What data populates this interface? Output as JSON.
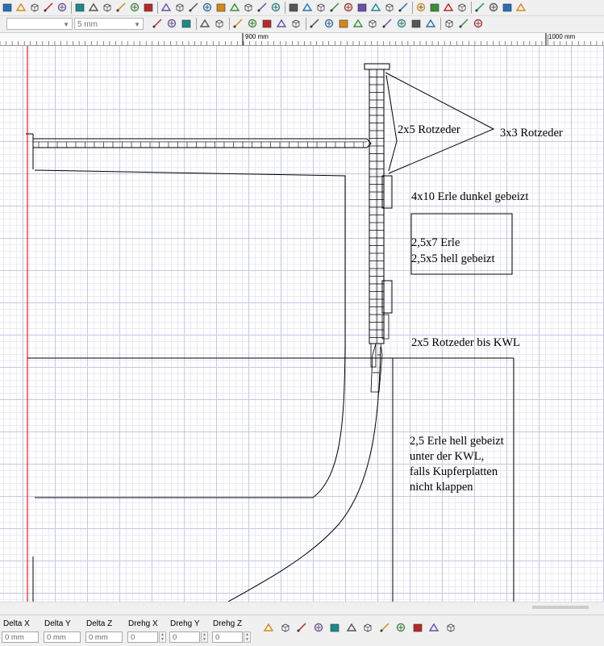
{
  "toolbar": {
    "layer_combo_value": "",
    "grid_combo_value": "5 mm",
    "icons_row1": [
      "open-folder-icon",
      "plot-icon",
      "measure-icon",
      "capture-icon",
      "stack-icon",
      "select-icon",
      "help-pointer-icon",
      "copy-icon",
      "print-icon",
      "paste-icon",
      "new-doc-icon",
      "axis-icon",
      "cube-top-icon",
      "cube-front-icon",
      "cube-side-icon",
      "cube-iso-icon",
      "cube-back-icon",
      "cube-right-icon",
      "cube-bottom-icon",
      "cube-view-icon",
      "surface-icon",
      "tilt-icon",
      "hull-icon",
      "point-icon",
      "curve-icon",
      "shape-icon",
      "line-icon",
      "flag-icon",
      "pin-icon",
      "grid-view-icon",
      "close-view-icon",
      "cut-icon",
      "brush-icon",
      "cycle-icon",
      "render-icon",
      "shade-icon",
      "camera-icon"
    ],
    "icons_row2": [
      "layers-icon",
      "mirror-icon",
      "double-icon",
      "add-point-icon",
      "trim-icon",
      "extend-icon",
      "line-tool-icon",
      "arc-icon",
      "circle-icon",
      "offset-icon",
      "select-all-icon",
      "cross-icon",
      "fillet-icon",
      "chamfer-icon",
      "join-icon",
      "split-icon",
      "marker-icon",
      "rotate-icon",
      "scale-icon",
      "magnet-icon",
      "dimension-icon",
      "angle-icon"
    ]
  },
  "ruler": {
    "labels": [
      "900 mm",
      "1000 mm"
    ]
  },
  "drawing": {
    "labels": [
      "2x5 Rotzeder",
      "3x3 Rotzeder",
      "4x10 Erle dunkel gebeizt",
      "2,5x7 Erle",
      "2,5x5 hell gebeizt",
      "2x5 Rotzeder bis KWL",
      "2,5 Erle hell gebeizt",
      "unter der KWL,",
      "falls Kupferplatten",
      "nicht klappen"
    ]
  },
  "statusbar": {
    "fields": [
      {
        "label": "Delta X",
        "value": "0 mm"
      },
      {
        "label": "Delta Y",
        "value": "0 mm"
      },
      {
        "label": "Delta Z",
        "value": "0 mm"
      },
      {
        "label": "Drehg X",
        "value": "0"
      },
      {
        "label": "Drehg Y",
        "value": "0"
      },
      {
        "label": "Drehg Z",
        "value": "0"
      }
    ],
    "icons": [
      "view-3d-icon",
      "render-view-icon",
      "curve-edit-icon",
      "warning-shape-icon",
      "frame-icon",
      "frame-select-icon",
      "move-icon",
      "move-x-icon",
      "move-y-icon",
      "rotate-view-icon",
      "scale-view-icon",
      "stretch-icon"
    ]
  }
}
